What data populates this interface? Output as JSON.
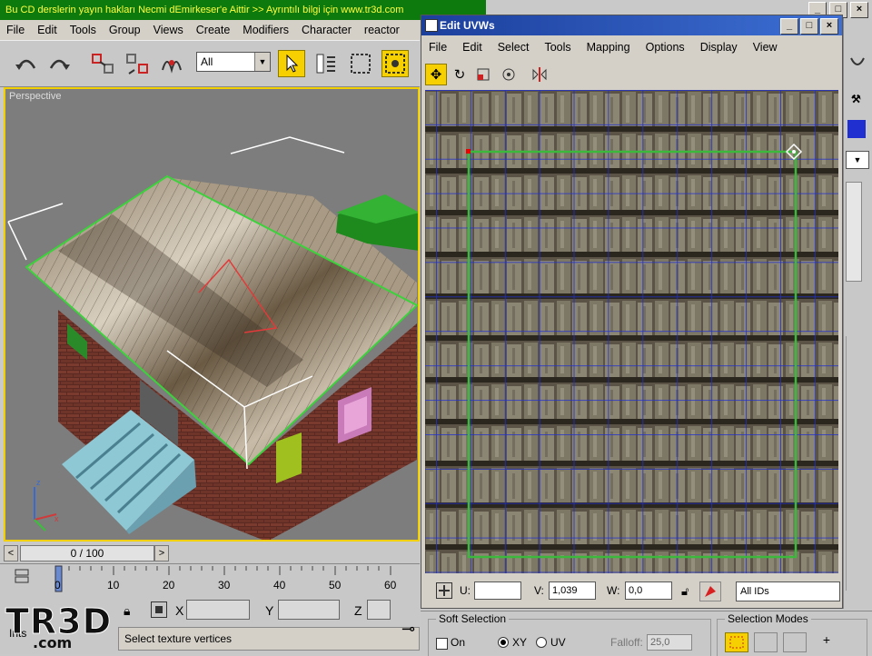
{
  "banner": {
    "text": "Bu CD derslerin yayın hakları Necmi dEmirkeser'e Aittir >> Ayrıntılı bilgi için  www.tr3d.com"
  },
  "window_buttons": {
    "minimize": "_",
    "maximize": "□",
    "close": "×"
  },
  "main_menu": {
    "items": [
      "File",
      "Edit",
      "Tools",
      "Group",
      "Views",
      "Create",
      "Modifiers",
      "Character",
      "reactor"
    ]
  },
  "main_toolbar": {
    "selection_filter": "All",
    "icons": [
      "undo-icon",
      "redo-icon",
      "link-icon",
      "unlink-icon",
      "bind-spacewarp-icon",
      "select-arrow-icon",
      "select-by-name-icon",
      "rect-selection-icon",
      "window-crossing-icon"
    ]
  },
  "viewport": {
    "label": "Perspective",
    "accent": "#f2d000"
  },
  "time_slider": {
    "label": "0 / 100",
    "prev": "<",
    "next": ">"
  },
  "ruler": {
    "ticks": [
      "0",
      "10",
      "20",
      "30",
      "40",
      "50",
      "60"
    ]
  },
  "coords": {
    "x_label": "X",
    "y_label": "Y",
    "z_label": "Z"
  },
  "status": {
    "prompt": "Select texture vertices",
    "script_label": "Ints"
  },
  "logo": {
    "main": "TR3D",
    "sub": ".com"
  },
  "edit_uvws": {
    "title": "Edit UVWs",
    "menu": [
      "File",
      "Edit",
      "Select",
      "Tools",
      "Mapping",
      "Options",
      "Display",
      "View"
    ],
    "bottom": {
      "u_label": "U:",
      "u_value": "",
      "v_label": "V:",
      "v_value": "1,039",
      "w_label": "W:",
      "w_value": "0,0",
      "ids_label": "All IDs"
    }
  },
  "bottom_panel": {
    "soft_selection": "Soft Selection",
    "on_label": "On",
    "xy_label": "XY",
    "uv_label": "UV",
    "falloff_label": "Falloff:",
    "falloff_value": "25,0",
    "selection_modes": "Selection Modes"
  },
  "colors": {
    "uv_grid": "#1f2fd0",
    "uv_border": "#3cb83c",
    "banner_bg": "#0d7a0d",
    "banner_text": "#ffff40",
    "title_bar": "#1c3f9c"
  }
}
